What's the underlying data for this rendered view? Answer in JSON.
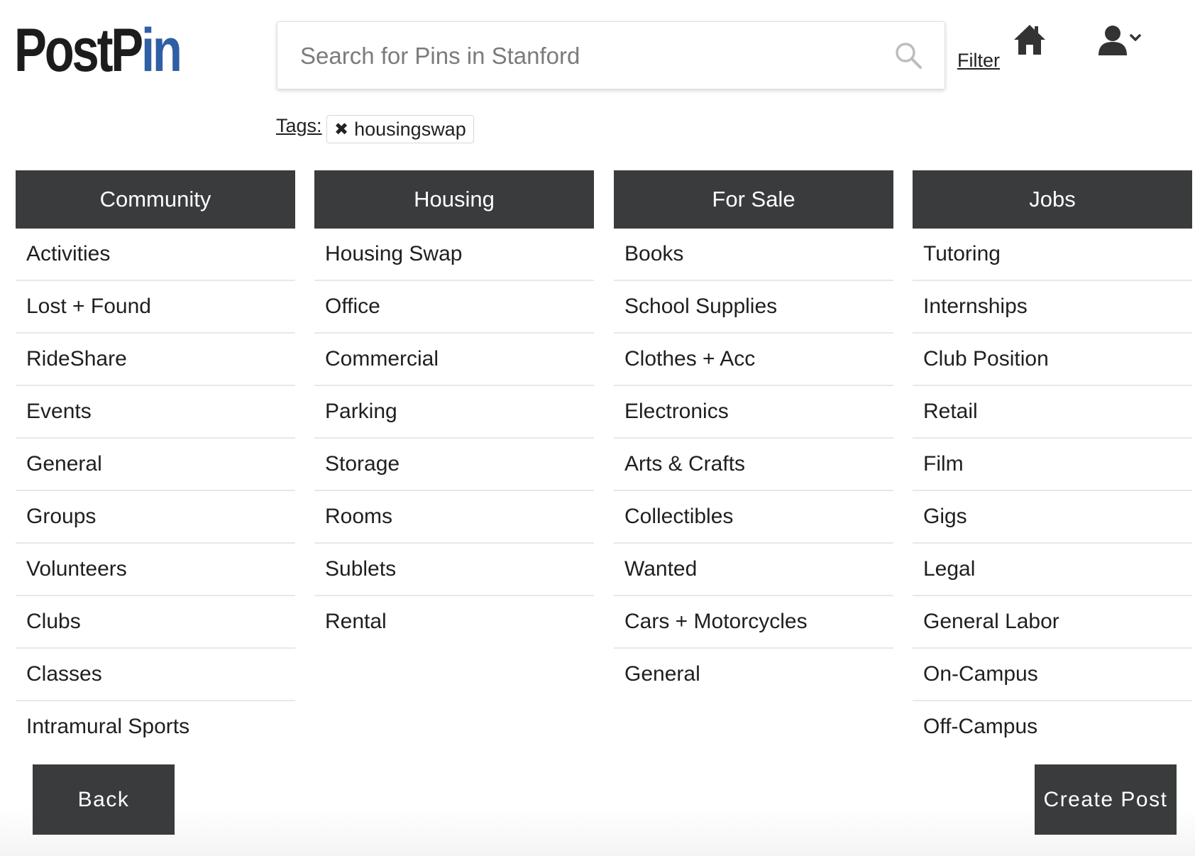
{
  "brand": {
    "logo_part1": "PostP",
    "logo_part2": "in"
  },
  "search": {
    "placeholder": "Search for Pins in Stanford",
    "value": ""
  },
  "header": {
    "filter_label": "Filter"
  },
  "tags": {
    "label": "Tags:",
    "items": [
      {
        "remove_glyph": "✖",
        "text": "housingswap"
      }
    ]
  },
  "columns": [
    {
      "title": "Community",
      "items": [
        "Activities",
        "Lost + Found",
        "RideShare",
        "Events",
        "General",
        "Groups",
        "Volunteers",
        "Clubs",
        "Classes",
        "Intramural Sports"
      ]
    },
    {
      "title": "Housing",
      "items": [
        "Housing Swap",
        "Office",
        "Commercial",
        "Parking",
        "Storage",
        "Rooms",
        "Sublets",
        "Rental"
      ]
    },
    {
      "title": "For Sale",
      "items": [
        "Books",
        "School Supplies",
        "Clothes + Acc",
        "Electronics",
        "Arts & Crafts",
        "Collectibles",
        "Wanted",
        "Cars + Motorcycles",
        "General"
      ]
    },
    {
      "title": "Jobs",
      "items": [
        "Tutoring",
        "Internships",
        "Club Position",
        "Retail",
        "Film",
        "Gigs",
        "Legal",
        "General Labor",
        "On-Campus",
        "Off-Campus"
      ]
    }
  ],
  "footer": {
    "back_label": "Back",
    "create_label": "Create Post"
  },
  "colors": {
    "header_bg": "#3a3b3d",
    "logo_blue": "#2f5fa5",
    "logo_dark": "#1c1c1c",
    "divider": "#e8e8e8"
  },
  "icons": {
    "search": "search-icon",
    "home": "home-icon",
    "user": "user-icon",
    "chevron": "chevron-down-icon",
    "tag_remove": "close-icon"
  }
}
